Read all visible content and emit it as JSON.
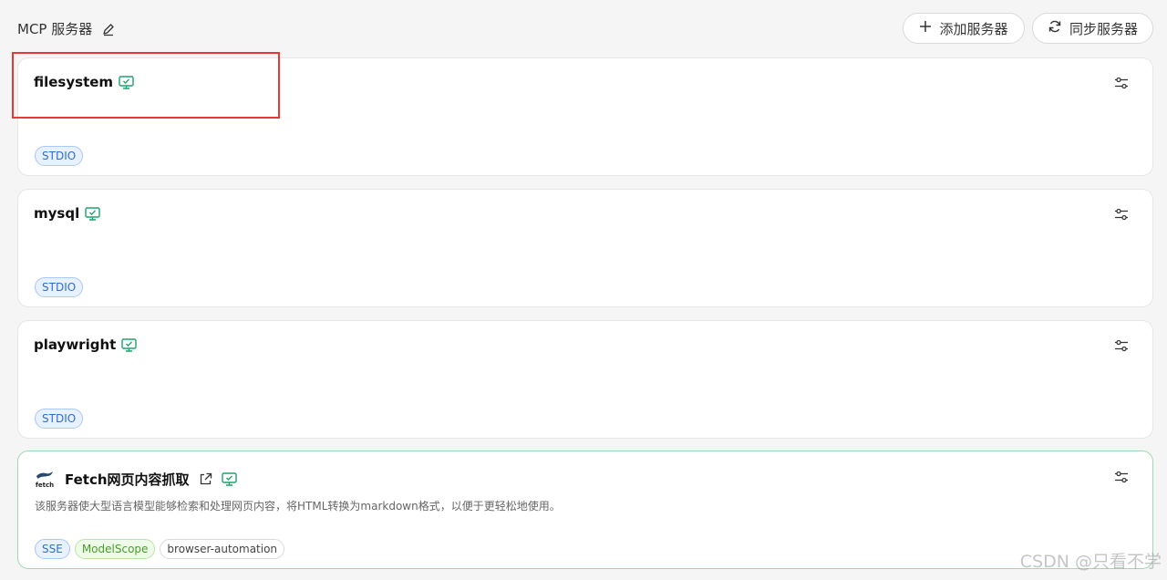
{
  "header": {
    "title": "MCP 服务器",
    "add_label": "添加服务器",
    "sync_label": "同步服务器"
  },
  "servers": [
    {
      "name": "filesystem",
      "tags": [
        "STDIO"
      ]
    },
    {
      "name": "mysql",
      "tags": [
        "STDIO"
      ]
    },
    {
      "name": "playwright",
      "tags": [
        "STDIO"
      ]
    },
    {
      "name": "Fetch网页内容抓取",
      "description": "该服务器使大型语言模型能够检索和处理网页内容，将HTML转换为markdown格式，以便于更轻松地使用。",
      "logo_text": "fetch",
      "tags": [
        "SSE",
        "ModelScope",
        "browser-automation"
      ]
    }
  ],
  "watermark": "CSDN @只看不学",
  "colors": {
    "accent_green": "#1fa36b",
    "highlight_red": "#e53935",
    "tag_blue": "#2f6fd1"
  }
}
